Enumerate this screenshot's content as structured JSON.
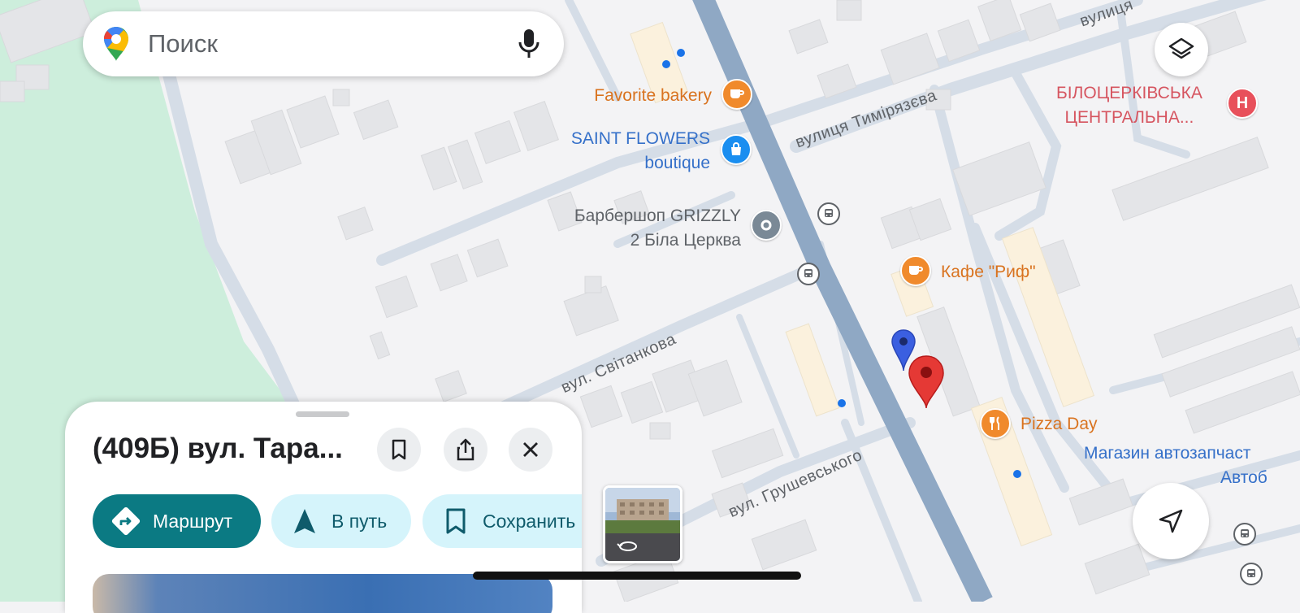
{
  "search": {
    "placeholder": "Поиск",
    "logo_icon": "google-maps-pin-icon",
    "mic_icon": "microphone-icon"
  },
  "map": {
    "colors": {
      "park": "#cdeedc",
      "background": "#f3f3f5",
      "main_road": "#8fa8c4",
      "road": "#d5dde7",
      "building": "#e4e5e8"
    },
    "pois": {
      "favorite_bakery": "Favorite bakery",
      "saint_flowers_1": "SAINT FLOWERS",
      "saint_flowers_2": "boutique",
      "barbershop_1": "Барбершоп GRIZZLY",
      "barbershop_2": "2 Біла Церква",
      "hospital_1": "БІЛОЦЕРКІВСЬКА",
      "hospital_2": "ЦЕНТРАЛЬНА...",
      "cafe_rif": "Кафе \"Риф\"",
      "pizza_day": "Pizza Day",
      "auto_parts": "Магазин автозапчаст",
      "auto_partial": "Автоб"
    },
    "streets": {
      "timiryazeva": "вулиця Тимірязєва",
      "svitankova": "вул. Світанкова",
      "hrushevskoho": "вул. Грушевського",
      "top_right": "вулиця"
    },
    "markers": {
      "selected": "red-location-pin-icon",
      "other": "blue-location-pin-icon"
    }
  },
  "controls": {
    "layers_icon": "layers-icon",
    "locate_icon": "navigation-arrow-icon"
  },
  "sheet": {
    "title": "(409Б) вул. Тара...",
    "save_icon": "bookmark-icon",
    "share_icon": "share-icon",
    "close_icon": "close-icon",
    "route_label": "Маршрут",
    "start_label": "В путь",
    "save_label": "Сохранить"
  },
  "street_view": {
    "icon": "rotate-360-icon"
  }
}
